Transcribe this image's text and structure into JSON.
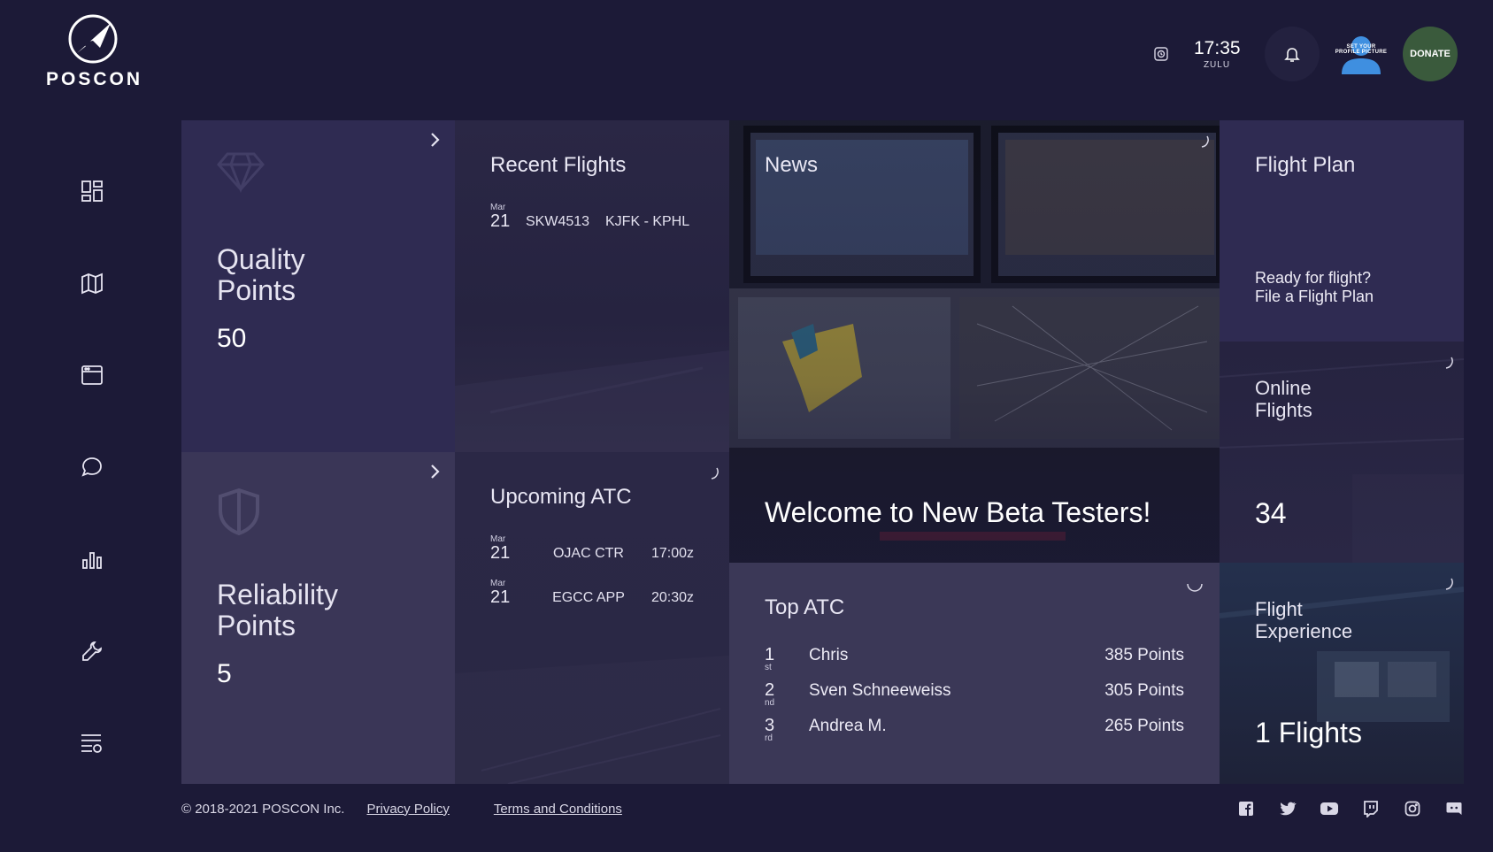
{
  "brand": {
    "name": "POSCON"
  },
  "sidebar": {
    "items": [
      {
        "icon": "dashboard-icon"
      },
      {
        "icon": "map-icon"
      },
      {
        "icon": "window-icon"
      },
      {
        "icon": "chat-icon"
      },
      {
        "icon": "bar-chart-icon"
      },
      {
        "icon": "wrench-icon"
      },
      {
        "icon": "list-settings-icon"
      }
    ]
  },
  "header": {
    "clock_time": "17:35",
    "clock_zone": "ZULU",
    "profile_line1": "SET YOUR",
    "profile_line2": "PROFILE PICTURE",
    "donate_label": "DONATE"
  },
  "quality": {
    "label_line1": "Quality",
    "label_line2": "Points",
    "value": "50"
  },
  "reliability": {
    "label_line1": "Reliability",
    "label_line2": "Points",
    "value": "5"
  },
  "recent_flights": {
    "title": "Recent Flights",
    "rows": [
      {
        "month": "Mar",
        "day": "21",
        "callsign": "SKW4513",
        "route": "KJFK - KPHL"
      }
    ]
  },
  "upcoming_atc": {
    "title": "Upcoming ATC",
    "rows": [
      {
        "month": "Mar",
        "day": "21",
        "position": "OJAC CTR",
        "time": "17:00z"
      },
      {
        "month": "Mar",
        "day": "21",
        "position": "EGCC APP",
        "time": "20:30z"
      }
    ]
  },
  "news": {
    "title": "News",
    "headline": "Welcome to New Beta Testers!"
  },
  "top_atc": {
    "title": "Top ATC",
    "rows": [
      {
        "rank": "1",
        "suffix": "st",
        "name": "Chris",
        "points": "385 Points"
      },
      {
        "rank": "2",
        "suffix": "nd",
        "name": "Sven Schneeweiss",
        "points": "305 Points"
      },
      {
        "rank": "3",
        "suffix": "rd",
        "name": "Andrea M.",
        "points": "265 Points"
      }
    ]
  },
  "flight_plan": {
    "title": "Flight Plan",
    "line1": "Ready for flight?",
    "line2": "File a Flight Plan"
  },
  "online_flights": {
    "title_line1": "Online",
    "title_line2": "Flights",
    "value": "34"
  },
  "flight_experience": {
    "title_line1": "Flight",
    "title_line2": "Experience",
    "value": "1 Flights"
  },
  "footer": {
    "copyright": "© 2018-2021 POSCON Inc.",
    "privacy": "Privacy Policy",
    "terms": "Terms and Conditions",
    "socials": [
      "facebook-icon",
      "twitter-icon",
      "youtube-icon",
      "twitch-icon",
      "instagram-icon",
      "discord-icon"
    ]
  },
  "colors": {
    "background": "#1c1a37",
    "tile_primary": "#2f2b52",
    "tile_secondary": "#3b3857",
    "donate": "#3a5a3c",
    "avatar": "#3f8fe0"
  }
}
